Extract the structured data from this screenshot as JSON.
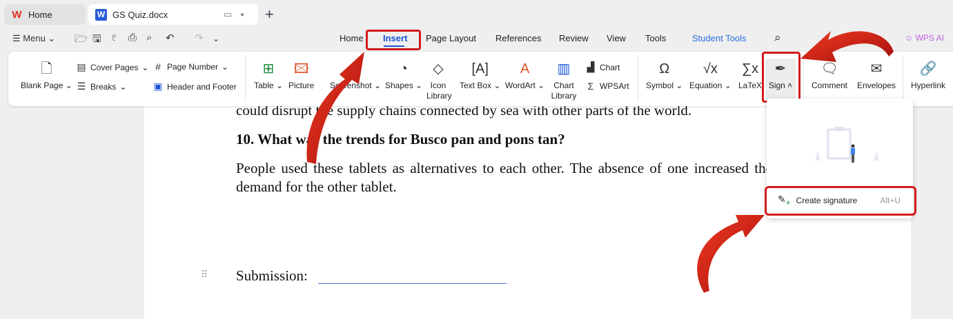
{
  "tabs": [
    {
      "label": "Home",
      "icon": "wps-logo"
    },
    {
      "label": "GS Quiz.docx",
      "icon": "word-doc-icon"
    }
  ],
  "toolbar": {
    "menu_label": "Menu"
  },
  "menu_tabs": [
    "Home",
    "Insert",
    "Page Layout",
    "References",
    "Review",
    "View",
    "Tools",
    "Student Tools"
  ],
  "wps_ai": "WPS AI",
  "ribbon": {
    "blank_page": "Blank Page",
    "cover_pages": "Cover Pages",
    "breaks": "Breaks",
    "page_number": "Page Number",
    "header_footer": "Header and Footer",
    "table": "Table",
    "picture": "Picture",
    "screenshot": "Screenshot",
    "shapes": "Shapes",
    "icon_library": "Icon Library",
    "text_box": "Text Box",
    "wordart": "WordArt",
    "chart_library": "Chart Library",
    "chart": "Chart",
    "wpsart": "WPSArt",
    "symbol": "Symbol",
    "equation": "Equation",
    "latex": "LaTeX",
    "sign": "Sign",
    "comment": "Comment",
    "envelopes": "Envelopes",
    "hyperlink": "Hyperlink"
  },
  "document": {
    "line1": "could disrupt the supply chains connected by sea with other parts of the world.",
    "heading": "10. What was the trends for Busco pan and pons tan?",
    "para1": "People used these tablets as alternatives to each other. The absence of one increased the",
    "para2": "demand for the other tablet.",
    "submission": "Submission:"
  },
  "sign_menu": {
    "create_signature": "Create signature",
    "shortcut": "Alt+U"
  },
  "colors": {
    "accent": "#1a56d6",
    "highlight": "#d11a1a",
    "student_tools": "#2b6fe0"
  }
}
